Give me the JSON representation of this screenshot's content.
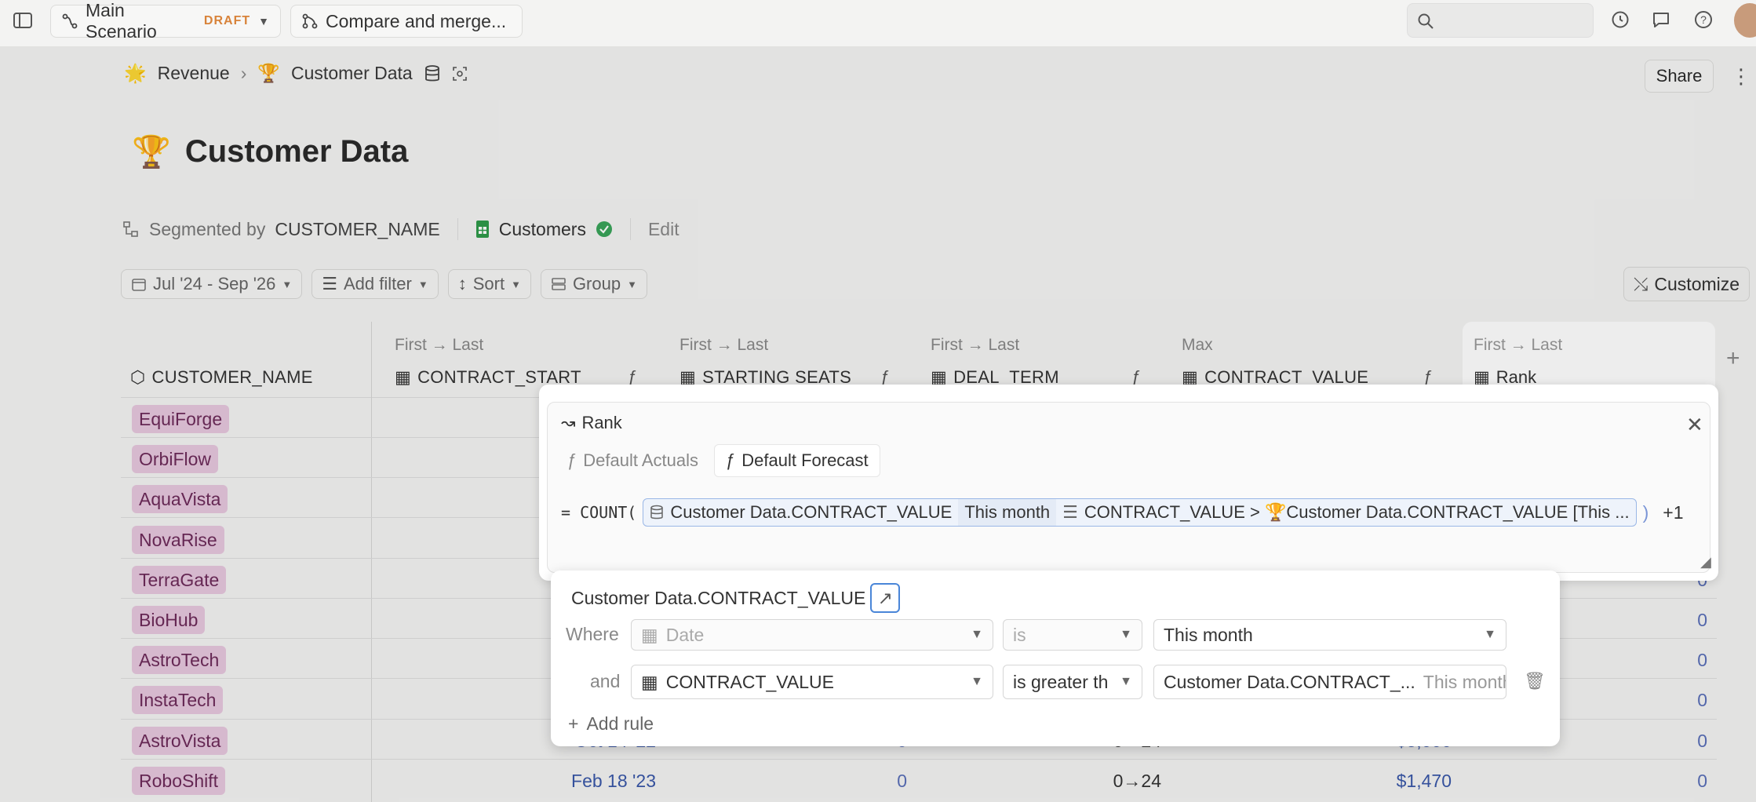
{
  "topbar": {
    "scenario": "Main Scenario",
    "draft": "DRAFT",
    "compare": "Compare and merge..."
  },
  "breadcrumb": {
    "parent": "Revenue",
    "current": "Customer Data",
    "share": "Share"
  },
  "page_title": "Customer Data",
  "segment": {
    "label": "Segmented by",
    "value": "CUSTOMER_NAME",
    "source": "Customers",
    "edit": "Edit"
  },
  "filters": {
    "date_range": "Jul '24 - Sep '26",
    "add_filter": "Add filter",
    "sort": "Sort",
    "group": "Group",
    "customize": "Customize"
  },
  "table": {
    "columns": [
      {
        "sub": "",
        "name": "CUSTOMER_NAME"
      },
      {
        "sub": "First → Last",
        "name": "CONTRACT_START"
      },
      {
        "sub": "First → Last",
        "name": "STARTING SEATS"
      },
      {
        "sub": "First → Last",
        "name": "DEAL_TERM"
      },
      {
        "sub": "Max",
        "name": "CONTRACT_VALUE"
      },
      {
        "sub": "First → Last",
        "name": "Rank"
      }
    ],
    "rows": [
      {
        "name": "EquiForge",
        "rank": ""
      },
      {
        "name": "OrbiFlow",
        "rank": ""
      },
      {
        "name": "AquaVista",
        "rank": ""
      },
      {
        "name": "NovaRise",
        "rank": ""
      },
      {
        "name": "TerraGate",
        "rank": "0"
      },
      {
        "name": "BioHub",
        "rank": "0"
      },
      {
        "name": "AstroTech",
        "rank": "0"
      },
      {
        "name": "InstaTech",
        "rank": "0"
      },
      {
        "name": "AstroVista",
        "start": "Oct 14 '22",
        "seats": "0",
        "term": "0→24",
        "value": "$3,000",
        "rank": "0"
      },
      {
        "name": "RoboShift",
        "start": "Feb 18 '23",
        "seats": "0",
        "term": "0→24",
        "value": "$1,470",
        "rank": "0"
      }
    ]
  },
  "formula": {
    "title": "Rank",
    "tab_actuals": "Default Actuals",
    "tab_forecast": "Default Forecast",
    "prefix": "= COUNT(",
    "ref_name": "Customer Data.CONTRACT_VALUE",
    "ref_period": "This month",
    "ref_filter": "CONTRACT_VALUE > 🏆Customer Data.CONTRACT_VALUE [This ...",
    "suffix": ")",
    "extra": "+1"
  },
  "popover": {
    "title": "Customer Data.CONTRACT_VALUE",
    "where": "Where",
    "and": "and",
    "rule1": {
      "field": "Date",
      "op": "is",
      "value": "This month"
    },
    "rule2": {
      "field": "CONTRACT_VALUE",
      "op": "is greater th",
      "value": "Customer Data.CONTRACT_...",
      "value_period": "This month"
    },
    "add_rule": "Add rule"
  }
}
